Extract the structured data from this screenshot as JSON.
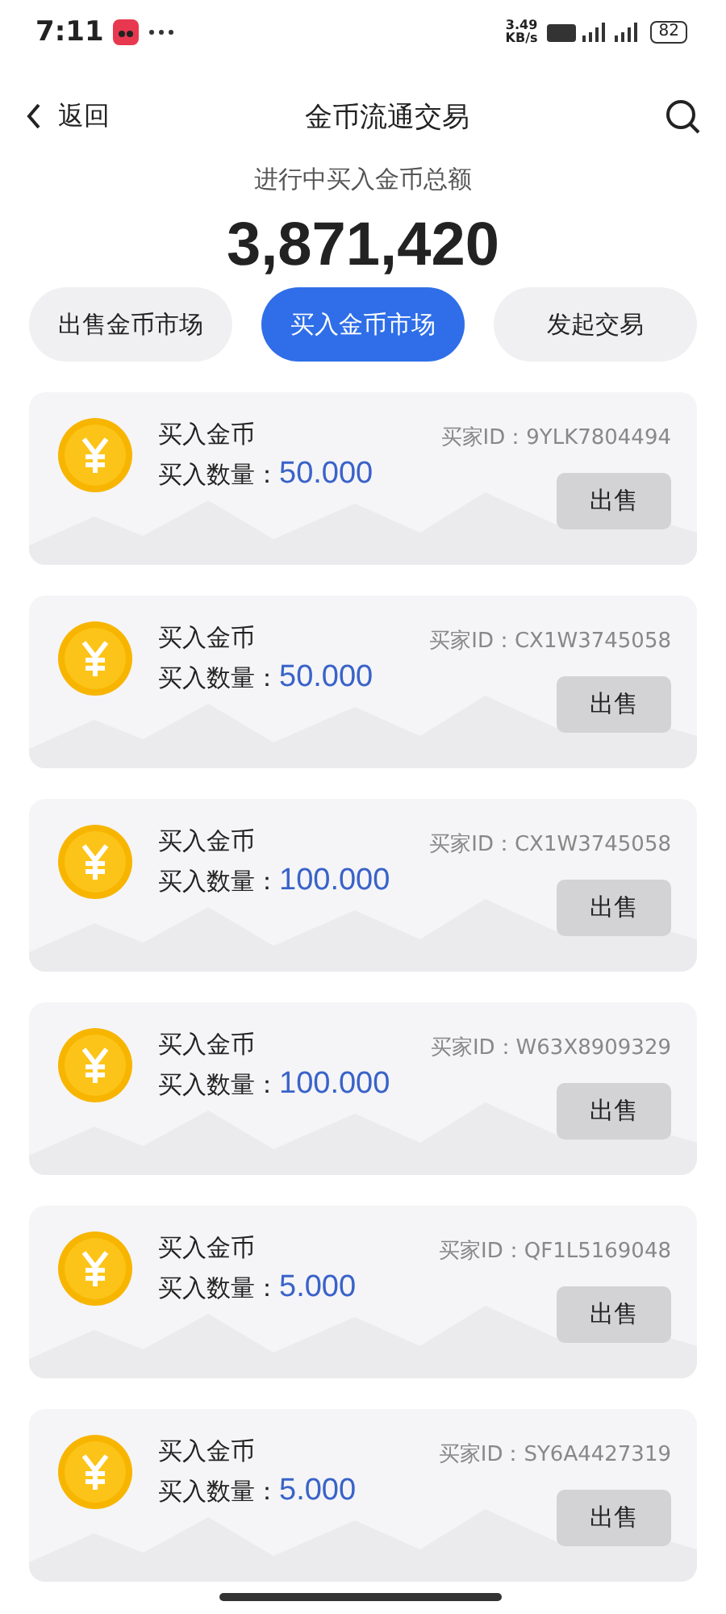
{
  "status_bar": {
    "time": "7:11",
    "speed": "3.49\nKB/s",
    "battery": "82"
  },
  "header": {
    "back": "返回",
    "title": "金币流通交易"
  },
  "summary": {
    "label": "进行中买入金币总额",
    "total": "3,871,420"
  },
  "tabs": [
    {
      "label": "出售金币市场",
      "selected": false
    },
    {
      "label": "买入金币市场",
      "selected": true
    },
    {
      "label": "发起交易",
      "selected": false
    }
  ],
  "orders": [
    {
      "title": "买入金币",
      "qty_label": "买入数量：",
      "qty": "50.000",
      "buyer": "买家ID：9YLK7804494",
      "action": "出售"
    },
    {
      "title": "买入金币",
      "qty_label": "买入数量：",
      "qty": "50.000",
      "buyer": "买家ID：CX1W3745058",
      "action": "出售"
    },
    {
      "title": "买入金币",
      "qty_label": "买入数量：",
      "qty": "100.000",
      "buyer": "买家ID：CX1W3745058",
      "action": "出售"
    },
    {
      "title": "买入金币",
      "qty_label": "买入数量：",
      "qty": "100.000",
      "buyer": "买家ID：W63X8909329",
      "action": "出售"
    },
    {
      "title": "买入金币",
      "qty_label": "买入数量：",
      "qty": "5.000",
      "buyer": "买家ID：QF1L5169048",
      "action": "出售"
    },
    {
      "title": "买入金币",
      "qty_label": "买入数量：",
      "qty": "5.000",
      "buyer": "买家ID：SY6A4427319",
      "action": "出售"
    }
  ]
}
